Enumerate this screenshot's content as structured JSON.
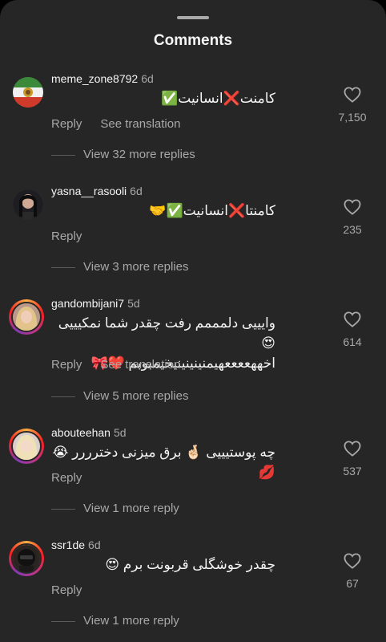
{
  "sheet": {
    "title": "Comments"
  },
  "comments": [
    {
      "username": "meme_zone8792",
      "time": "6d",
      "text_lines": [
        "کامنت❌انسانیت✅"
      ],
      "actions": [
        "Reply",
        "See translation"
      ],
      "likes": "7,150",
      "replies": "View 32 more replies",
      "avatar": "flag-avatar",
      "story_ring": false
    },
    {
      "username": "yasna__rasooli",
      "time": "6d",
      "text_lines": [
        "کامنتا❌انسانیت✅🤝"
      ],
      "actions": [
        "Reply"
      ],
      "likes": "235",
      "replies": "View 3 more replies",
      "avatar": "portrait-avatar",
      "story_ring": false
    },
    {
      "username": "gandombijani7",
      "time": "5d",
      "text_lines": [
        "وایییی دلمممم رفت چقدر شما نمکیییی 😍",
        "اخههععععهیمنینینینیخیمبوبم ❤️🎀"
      ],
      "actions": [
        "Reply",
        "See translation"
      ],
      "likes": "614",
      "replies": "View 5 more replies",
      "avatar": "blonde-avatar",
      "story_ring": true
    },
    {
      "username": "abouteehan",
      "time": "5d",
      "text_lines": [
        "چه پوستیییی 🤞🏻 برق میزنی دخترررر 😭💋"
      ],
      "actions": [
        "Reply"
      ],
      "likes": "537",
      "replies": "View 1 more reply",
      "avatar": "blonde-avatar",
      "story_ring": true
    },
    {
      "username": "ssr1de",
      "time": "6d",
      "text_lines": [
        "چقدر خوشگلی قربونت برم 😍"
      ],
      "actions": [
        "Reply"
      ],
      "likes": "67",
      "replies": "View 1 more reply",
      "avatar": "helmet-avatar",
      "story_ring": true
    }
  ],
  "icons": {
    "like": "heart-outline-icon"
  },
  "colors": {
    "sheet_bg": "#262626",
    "secondary_text": "#a8a8a8",
    "primary_text": "#f5f5f5"
  }
}
